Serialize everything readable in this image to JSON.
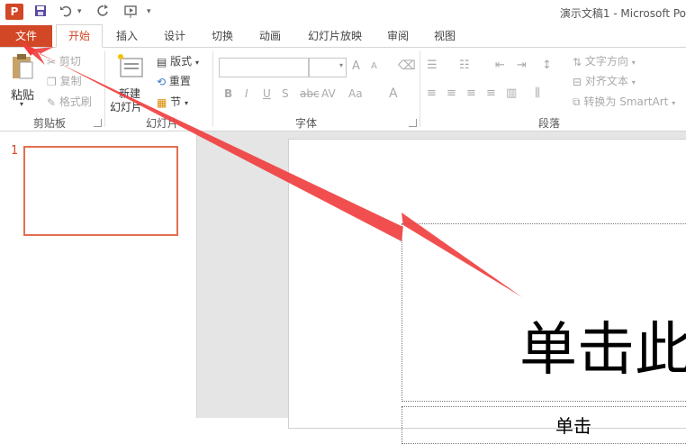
{
  "window": {
    "title": "演示文稿1 - Microsoft Po"
  },
  "app": {
    "logo": "P"
  },
  "quick_access": {
    "save_icon": "save-icon",
    "undo_icon": "undo-icon",
    "redo_icon": "redo-icon"
  },
  "tabs": [
    {
      "label": "文件"
    },
    {
      "label": "开始"
    },
    {
      "label": "插入"
    },
    {
      "label": "设计"
    },
    {
      "label": "切换"
    },
    {
      "label": "动画"
    },
    {
      "label": "幻灯片放映"
    },
    {
      "label": "审阅"
    },
    {
      "label": "视图"
    }
  ],
  "clipboard": {
    "paste": "粘贴",
    "cut": "剪切",
    "copy": "复制",
    "format_painter": "格式刷",
    "group": "剪贴板"
  },
  "slides_group": {
    "new_slide_line1": "新建",
    "new_slide_line2": "幻灯片",
    "layout": "版式",
    "reset": "重置",
    "section": "节",
    "group": "幻灯片"
  },
  "font_group": {
    "bold": "B",
    "italic": "I",
    "underline": "U",
    "shadow": "S",
    "strike": "abc",
    "spacing": "AV",
    "case": "Aa",
    "grow": "A",
    "shrink": "A",
    "color": "A",
    "group": "字体"
  },
  "paragraph_group": {
    "text_direction": "文字方向",
    "align_text": "对齐文本",
    "smartart": "转换为 SmartArt",
    "group": "段落"
  },
  "slide_panel": {
    "slide_number": "1"
  },
  "slide": {
    "title_placeholder": "单击此",
    "subtitle_placeholder": "单击"
  },
  "colors": {
    "accent": "#d24726",
    "arrow": "#f03c3c"
  }
}
